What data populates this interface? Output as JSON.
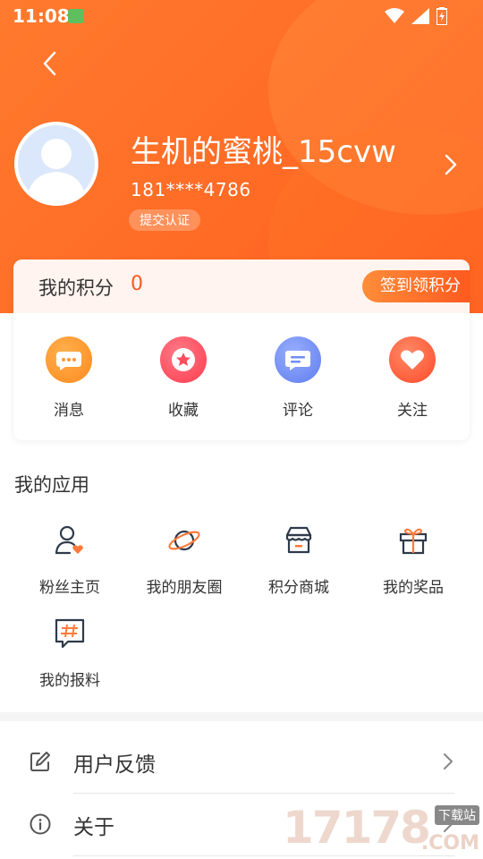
{
  "status_bar": {
    "time": "11:08"
  },
  "profile": {
    "username": "生机的蜜桃_15cvw",
    "phone": "181****4786",
    "verify_label": "提交认证"
  },
  "points": {
    "label": "我的积分",
    "value": "0",
    "checkin_label": "签到领积分"
  },
  "quick_actions": [
    {
      "label": "消息",
      "icon": "message-icon",
      "color": "#ff9933"
    },
    {
      "label": "收藏",
      "icon": "star-icon",
      "color": "#ff4d5e"
    },
    {
      "label": "评论",
      "icon": "comment-icon",
      "color": "#6f8cf5"
    },
    {
      "label": "关注",
      "icon": "heart-icon",
      "color": "#ff5a3c"
    }
  ],
  "my_apps": {
    "title": "我的应用",
    "items": [
      {
        "label": "粉丝主页",
        "icon": "fan-user-icon"
      },
      {
        "label": "我的朋友圈",
        "icon": "planet-icon"
      },
      {
        "label": "积分商城",
        "icon": "store-icon"
      },
      {
        "label": "我的奖品",
        "icon": "gift-icon"
      },
      {
        "label": "我的报料",
        "icon": "hashtag-icon"
      }
    ]
  },
  "menu": [
    {
      "label": "用户反馈",
      "icon": "edit-icon"
    },
    {
      "label": "关于",
      "icon": "info-icon"
    }
  ],
  "watermark": {
    "numbers": "17178",
    "badge": "下载站",
    "domain": ".COM"
  },
  "colors": {
    "accent": "#ff6a24",
    "points_value": "#ff5a1f",
    "app_icon_stroke": "#2f3a4a",
    "app_icon_accent": "#ff7a3a"
  }
}
